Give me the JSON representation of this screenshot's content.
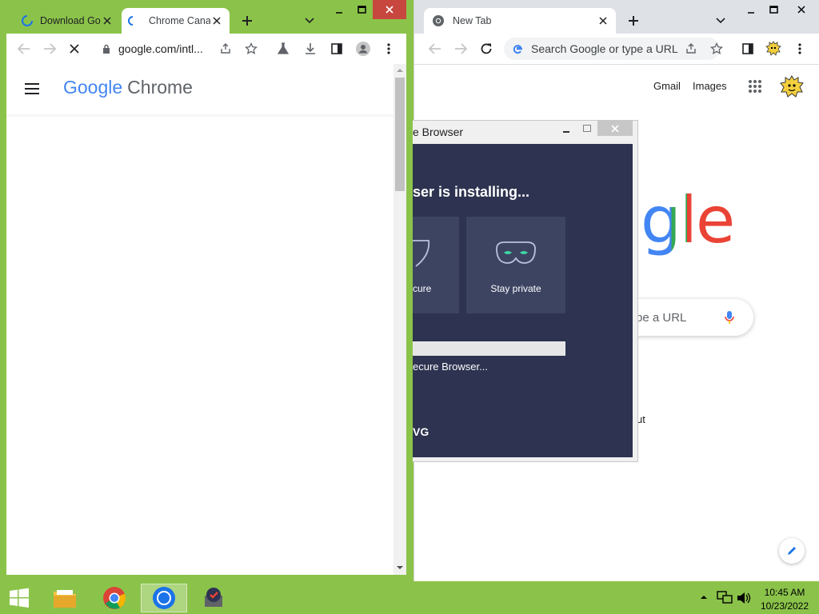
{
  "left_window": {
    "tabs": [
      {
        "label": "Download Go",
        "favicon": "loading-spinner-icon"
      },
      {
        "label": "Chrome Cana",
        "favicon": "loading-spinner-icon"
      }
    ],
    "url": "google.com/intl...",
    "page_logo_word1": "Google",
    "page_logo_word2": "Chrome"
  },
  "right_window": {
    "tabs": [
      {
        "label": "New Tab",
        "favicon": "chrome-icon"
      }
    ],
    "omnibox_placeholder": "Search Google or type a URL",
    "header_links": {
      "gmail": "Gmail",
      "images": "Images"
    },
    "logo_partial": "gle",
    "search_placeholder_partial": "pe a URL",
    "partial_text": "ut"
  },
  "installer": {
    "title": "e Browser",
    "heading": "ser is installing...",
    "card1_label": "cure",
    "card2_label": "Stay private",
    "progress_percent": 0,
    "status_text": "ecure Browser...",
    "brand": "VG"
  },
  "taskbar": {
    "time": "10:45 AM",
    "date": "10/23/2022"
  },
  "colors": {
    "frame": "#8bc34a",
    "installer_bg": "#2d3350",
    "installer_card": "#3d4462",
    "google_blue": "#4285f4",
    "google_red": "#ea4335",
    "google_yellow": "#fbbc05",
    "google_green": "#34a853"
  }
}
